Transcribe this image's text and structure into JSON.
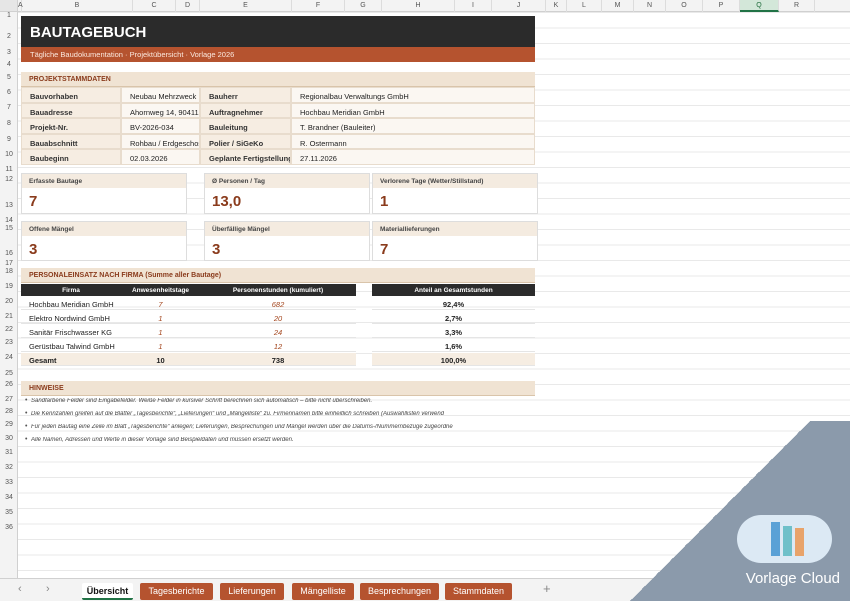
{
  "columns": [
    "A",
    "B",
    "C",
    "D",
    "E",
    "F",
    "G",
    "H",
    "I",
    "J",
    "K",
    "L",
    "M",
    "N",
    "O",
    "P",
    "Q",
    "R"
  ],
  "rows": [
    1,
    2,
    3,
    4,
    5,
    6,
    7,
    8,
    9,
    10,
    11,
    12,
    13,
    14,
    15,
    16,
    17,
    18,
    19,
    20,
    21,
    22,
    23,
    24,
    25,
    26,
    27,
    28,
    29,
    30,
    31,
    32,
    33,
    34,
    35,
    36
  ],
  "title": "BAUTAGEBUCH",
  "subtitle": "Tägliche Baudokumentation  ·  Projektübersicht  ·  Vorlage 2026",
  "stamm": {
    "heading": "PROJEKTSTAMMDATEN",
    "left": [
      {
        "label": "Bauvorhaben",
        "value": "Neubau Mehrzweck"
      },
      {
        "label": "Bauadresse",
        "value": "Ahornweg 14, 90411"
      },
      {
        "label": "Projekt-Nr.",
        "value": "BV-2026-034"
      },
      {
        "label": "Bauabschnitt",
        "value": "Rohbau / Erdgeschos"
      },
      {
        "label": "Baubeginn",
        "value": "02.03.2026"
      }
    ],
    "right": [
      {
        "label": "Bauherr",
        "value": "Regionalbau Verwaltungs GmbH"
      },
      {
        "label": "Auftragnehmer",
        "value": "Hochbau Meridian GmbH"
      },
      {
        "label": "Bauleitung",
        "value": "T. Brandner (Bauleiter)"
      },
      {
        "label": "Polier / SiGeKo",
        "value": "R. Ostermann"
      },
      {
        "label": "Geplante Fertigstellung",
        "value": "27.11.2026"
      }
    ]
  },
  "kpis": [
    {
      "label": "Erfasste Bautage",
      "value": "7"
    },
    {
      "label": "Ø Personen / Tag",
      "value": "13,0"
    },
    {
      "label": "Verlorene Tage (Wetter/Stillstand)",
      "value": "1"
    },
    {
      "label": "Offene Mängel",
      "value": "3"
    },
    {
      "label": "Überfällige Mängel",
      "value": "3"
    },
    {
      "label": "Materiallieferungen",
      "value": "7"
    }
  ],
  "personal": {
    "heading": "PERSONALEINSATZ NACH FIRMA  (Summe aller Bautage)",
    "headers": [
      "Firma",
      "Anwesenheitstage",
      "Personenstunden (kumuliert)",
      "Anteil an Gesamtstunden"
    ],
    "rows": [
      {
        "firma": "Hochbau Meridian GmbH",
        "tage": "7",
        "stunden": "682",
        "anteil": "92,4%"
      },
      {
        "firma": "Elektro Nordwind GmbH",
        "tage": "1",
        "stunden": "20",
        "anteil": "2,7%"
      },
      {
        "firma": "Sanitär Frischwasser KG",
        "tage": "1",
        "stunden": "24",
        "anteil": "3,3%"
      },
      {
        "firma": "Gerüstbau Talwind GmbH",
        "tage": "1",
        "stunden": "12",
        "anteil": "1,6%"
      }
    ],
    "total": {
      "firma": "Gesamt",
      "tage": "10",
      "stunden": "738",
      "anteil": "100,0%"
    }
  },
  "hinweise": {
    "heading": "HINWEISE",
    "items": [
      "Sandfarbene Felder sind Eingabefelder. Weiße Felder in kursiver Schrift berechnen sich automatisch – bitte nicht überschreiben.",
      "Die Kennzahlen greifen auf die Blätter „Tagesberichte“, „Lieferungen“ und „Mängelliste“ zu. Firmennamen bitte einheitlich schreiben (Auswahllisten verwend",
      "Für jeden Bautag eine Zeile im Blatt „Tagesberichte“ anlegen; Lieferungen, Besprechungen und Mängel werden über die Datums-/Nummernbezüge zugeordne",
      "Alle Namen, Adressen und Werte in dieser Vorlage sind Beispieldaten und müssen ersetzt werden."
    ]
  },
  "tabs": [
    "Übersicht",
    "Tagesberichte",
    "Lieferungen",
    "Mängelliste",
    "Besprechungen",
    "Stammdaten"
  ],
  "watermark": "Vorlage Cloud",
  "colors": {
    "accent": "#b5532f",
    "dark": "#2b2b2b",
    "sand": "#f0e3d3",
    "excel_green": "#217346"
  }
}
